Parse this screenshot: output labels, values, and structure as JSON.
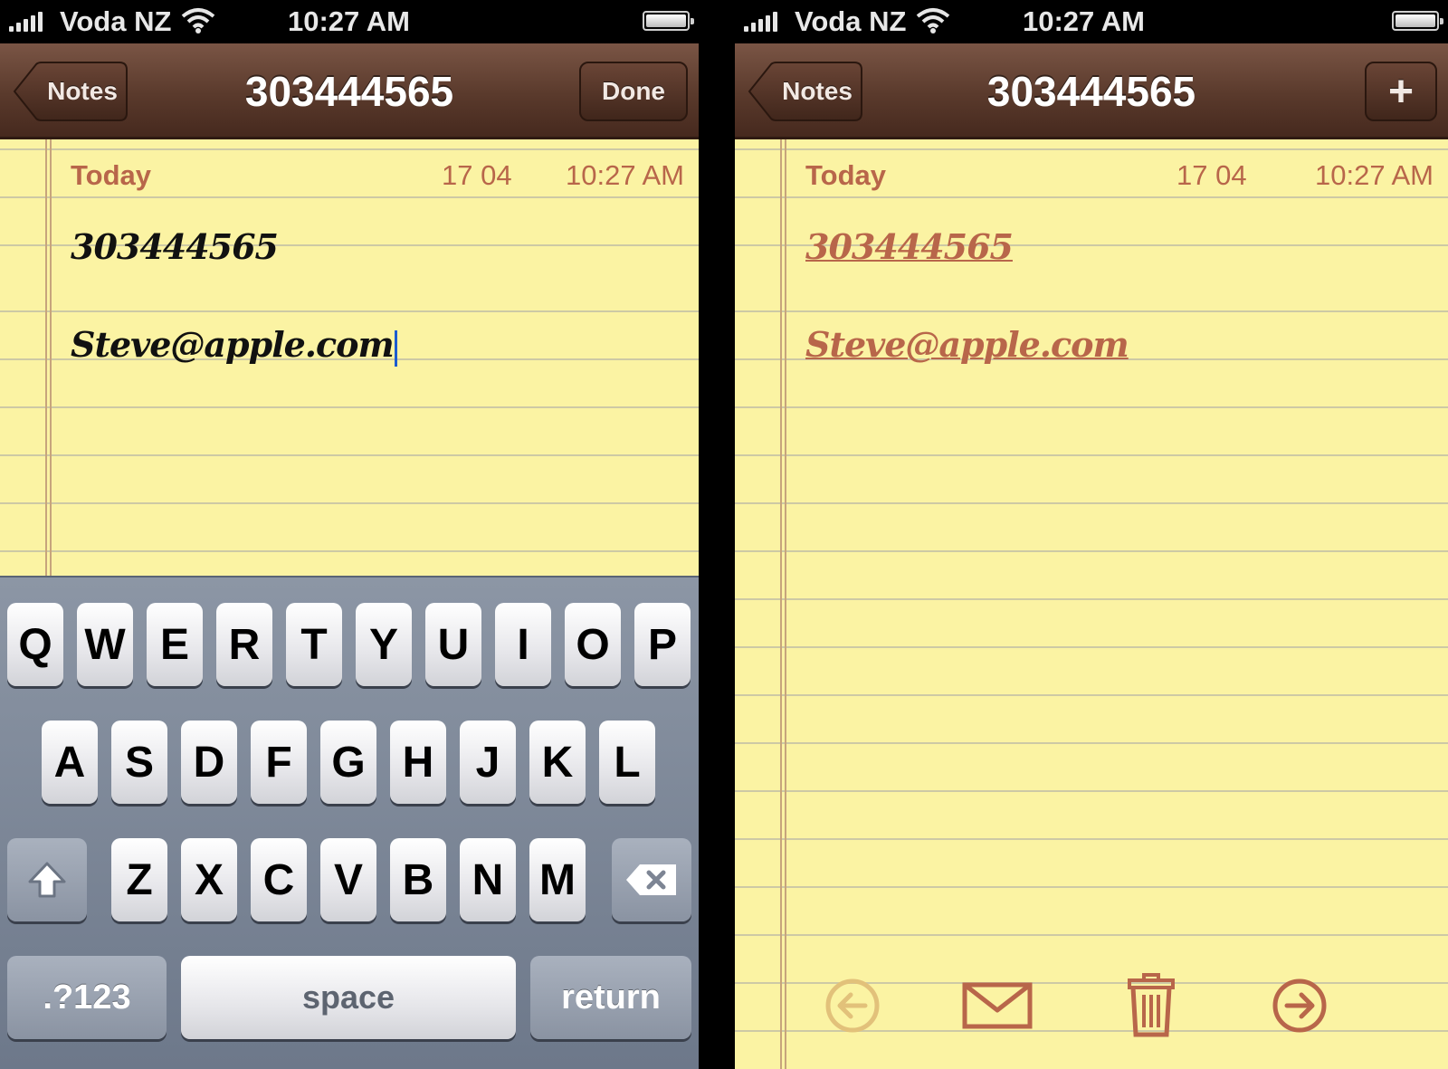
{
  "status_bar": {
    "carrier": "Voda NZ",
    "time": "10:27 AM"
  },
  "nav": {
    "back_label": "Notes",
    "title": "303444565",
    "done_label": "Done",
    "plus_label": "+"
  },
  "note": {
    "day": "Today",
    "date": "17 04",
    "time": "10:27 AM",
    "lines": [
      "303444565",
      "Steve@apple.com"
    ]
  },
  "keyboard": {
    "row1": [
      "Q",
      "W",
      "E",
      "R",
      "T",
      "Y",
      "U",
      "I",
      "O",
      "P"
    ],
    "row2": [
      "A",
      "S",
      "D",
      "F",
      "G",
      "H",
      "J",
      "K",
      "L"
    ],
    "row3": [
      "Z",
      "X",
      "C",
      "V",
      "B",
      "N",
      "M"
    ],
    "numbers_label": ".?123",
    "space_label": "space",
    "return_label": "return"
  },
  "toolbar_icons": [
    "previous-note-icon",
    "mail-icon",
    "trash-icon",
    "next-note-icon"
  ],
  "colors": {
    "paper": "#fbf3a3",
    "header_text": "#b8664a",
    "nav_brown": "#5a3a2c",
    "keyboard": "#7b8597"
  }
}
